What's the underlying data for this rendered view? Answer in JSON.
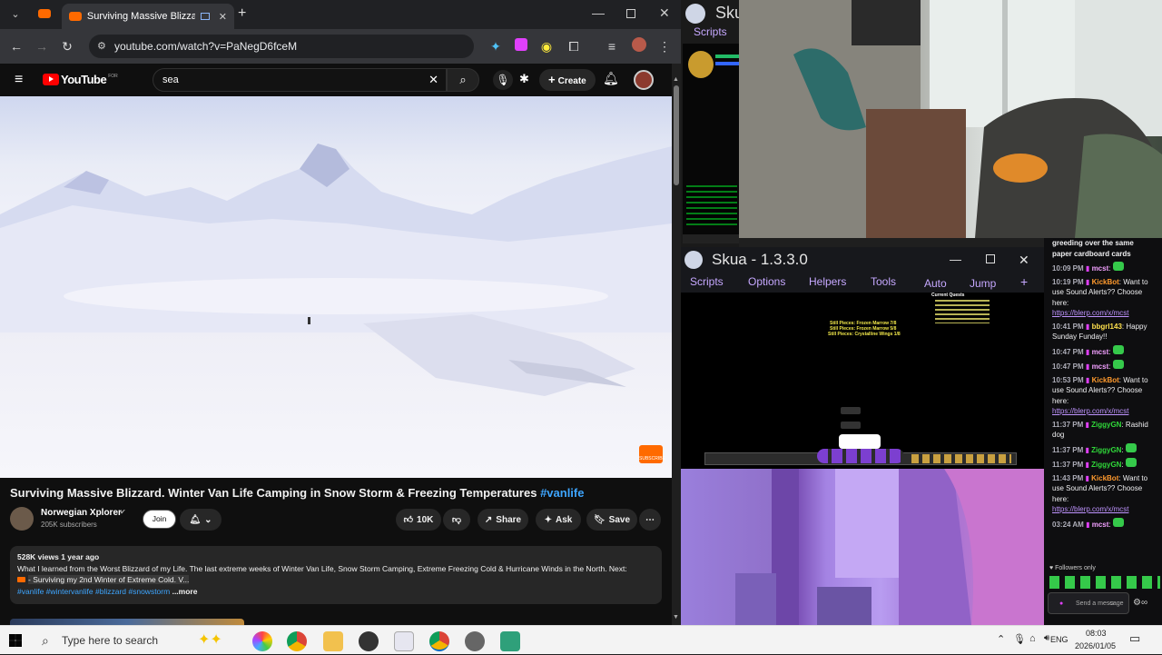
{
  "browser": {
    "tab_title": "Surviving Massive Blizzard.",
    "url": "youtube.com/watch?v=PaNegD6fceM"
  },
  "youtube": {
    "logo_text": "YouTube",
    "logo_sup": "FOR",
    "search_value": "sea",
    "create_label": "Create",
    "video_title": "Surviving Massive Blizzard. Winter Van Life Camping in Snow Storm & Freezing Temperatures",
    "video_hashtag": "#vanlife",
    "subscribe_watermark": "SUBSCRIBE",
    "channel_name": "Norwegian Xplorer",
    "channel_subs": "205K subscribers",
    "join_label": "Join",
    "likes": "10K",
    "share_label": "Share",
    "ask_label": "Ask",
    "save_label": "Save",
    "views_date": "528K views  1 year ago",
    "desc_line1": "What I learned from the Worst Blizzard of my Life. The last extreme weeks of Winter Van Life, Snow Storm Camping, Extreme Freezing Cold & Hurricane Winds in the North. Next:",
    "desc_line2": "- Surviving my 2nd Winter of Extreme Cold. V...",
    "desc_tags": "#vanlife #wintervanlife #blizzard #snowstorm",
    "more_label": "...more"
  },
  "skua": {
    "title_short": "Sku",
    "scripts_short": "Scripts",
    "title": "Skua - 1.3.3.0",
    "menu": [
      "Scripts",
      "Options",
      "Helpers",
      "Tools",
      "Auto",
      "Jump",
      "+"
    ],
    "quests_header": "Current Quests",
    "drops": [
      "Still Pieces: Frozen Marrow 7/8",
      "Still Pieces: Frozen Marrow 5/8",
      "Still Pieces: Crystalline Wings 1/8"
    ]
  },
  "chat": {
    "top_text": "greeding over the same paper cardboard cards",
    "messages": [
      {
        "time": "10:09 PM",
        "user": "mcst",
        "color": "#f2a0ff",
        "text": ""
      },
      {
        "time": "10:19 PM",
        "user": "KickBot",
        "color": "#ff9a2e",
        "text": "Want to use Sound Alerts?? Choose here:",
        "link": "https://blerp.com/x/mcst"
      },
      {
        "time": "10:41 PM",
        "user": "bbgrl143",
        "color": "#ffe14d",
        "text": "Happy Sunday Funday!!"
      },
      {
        "time": "10:47 PM",
        "user": "mcst",
        "color": "#f2a0ff",
        "text": ""
      },
      {
        "time": "10:47 PM",
        "user": "mcst",
        "color": "#f2a0ff",
        "text": ""
      },
      {
        "time": "10:53 PM",
        "user": "KickBot",
        "color": "#ff9a2e",
        "text": "Want to use Sound Alerts?? Choose here:",
        "link": "https://blerp.com/x/mcst"
      },
      {
        "time": "11:37 PM",
        "user": "ZiggyGN",
        "color": "#30d93a",
        "text": "Rashid dog"
      },
      {
        "time": "11:37 PM",
        "user": "ZiggyGN",
        "color": "#30d93a",
        "text": ""
      },
      {
        "time": "11:37 PM",
        "user": "ZiggyGN",
        "color": "#30d93a",
        "text": ""
      },
      {
        "time": "11:43 PM",
        "user": "KickBot",
        "color": "#ff9a2e",
        "text": "Want to use Sound Alerts?? Choose here:",
        "link": "https://blerp.com/x/mcst"
      },
      {
        "time": "03:24 AM",
        "user": "mcst",
        "color": "#f2a0ff",
        "text": ""
      }
    ],
    "followers_only": "Followers only",
    "send_placeholder": "Send a message"
  },
  "taskbar": {
    "search_placeholder": "Type here to search",
    "lang": "ENG",
    "time": "08:03",
    "date": "2026/01/05"
  },
  "colors": {
    "yt_red": "#ff0000",
    "chat_bg": "#0e0e10",
    "skua_accent": "#c6a8ff"
  }
}
